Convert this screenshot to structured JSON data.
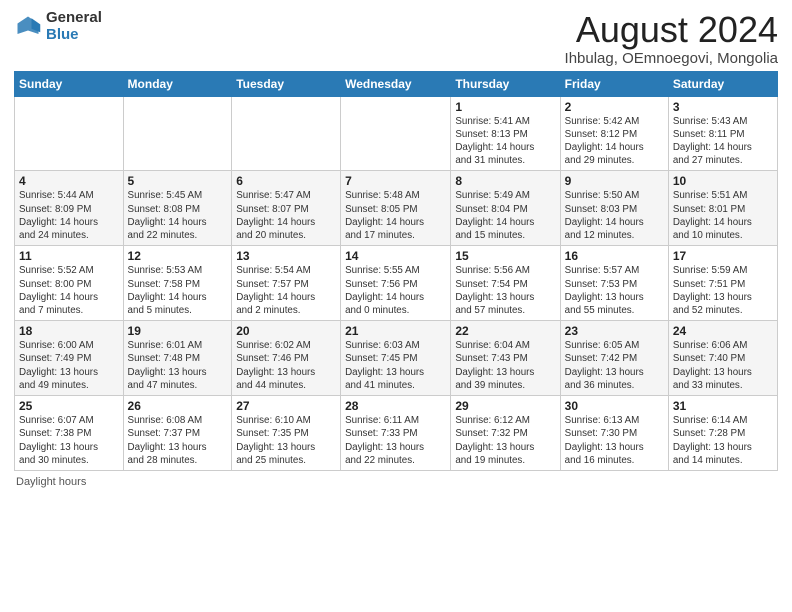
{
  "header": {
    "logo_line1": "General",
    "logo_line2": "Blue",
    "main_title": "August 2024",
    "sub_title": "Ihbulag, OEmnoegovi, Mongolia"
  },
  "days": [
    "Sunday",
    "Monday",
    "Tuesday",
    "Wednesday",
    "Thursday",
    "Friday",
    "Saturday"
  ],
  "weeks": [
    [
      {
        "date": "",
        "info": ""
      },
      {
        "date": "",
        "info": ""
      },
      {
        "date": "",
        "info": ""
      },
      {
        "date": "",
        "info": ""
      },
      {
        "date": "1",
        "info": "Sunrise: 5:41 AM\nSunset: 8:13 PM\nDaylight: 14 hours\nand 31 minutes."
      },
      {
        "date": "2",
        "info": "Sunrise: 5:42 AM\nSunset: 8:12 PM\nDaylight: 14 hours\nand 29 minutes."
      },
      {
        "date": "3",
        "info": "Sunrise: 5:43 AM\nSunset: 8:11 PM\nDaylight: 14 hours\nand 27 minutes."
      }
    ],
    [
      {
        "date": "4",
        "info": "Sunrise: 5:44 AM\nSunset: 8:09 PM\nDaylight: 14 hours\nand 24 minutes."
      },
      {
        "date": "5",
        "info": "Sunrise: 5:45 AM\nSunset: 8:08 PM\nDaylight: 14 hours\nand 22 minutes."
      },
      {
        "date": "6",
        "info": "Sunrise: 5:47 AM\nSunset: 8:07 PM\nDaylight: 14 hours\nand 20 minutes."
      },
      {
        "date": "7",
        "info": "Sunrise: 5:48 AM\nSunset: 8:05 PM\nDaylight: 14 hours\nand 17 minutes."
      },
      {
        "date": "8",
        "info": "Sunrise: 5:49 AM\nSunset: 8:04 PM\nDaylight: 14 hours\nand 15 minutes."
      },
      {
        "date": "9",
        "info": "Sunrise: 5:50 AM\nSunset: 8:03 PM\nDaylight: 14 hours\nand 12 minutes."
      },
      {
        "date": "10",
        "info": "Sunrise: 5:51 AM\nSunset: 8:01 PM\nDaylight: 14 hours\nand 10 minutes."
      }
    ],
    [
      {
        "date": "11",
        "info": "Sunrise: 5:52 AM\nSunset: 8:00 PM\nDaylight: 14 hours\nand 7 minutes."
      },
      {
        "date": "12",
        "info": "Sunrise: 5:53 AM\nSunset: 7:58 PM\nDaylight: 14 hours\nand 5 minutes."
      },
      {
        "date": "13",
        "info": "Sunrise: 5:54 AM\nSunset: 7:57 PM\nDaylight: 14 hours\nand 2 minutes."
      },
      {
        "date": "14",
        "info": "Sunrise: 5:55 AM\nSunset: 7:56 PM\nDaylight: 14 hours\nand 0 minutes."
      },
      {
        "date": "15",
        "info": "Sunrise: 5:56 AM\nSunset: 7:54 PM\nDaylight: 13 hours\nand 57 minutes."
      },
      {
        "date": "16",
        "info": "Sunrise: 5:57 AM\nSunset: 7:53 PM\nDaylight: 13 hours\nand 55 minutes."
      },
      {
        "date": "17",
        "info": "Sunrise: 5:59 AM\nSunset: 7:51 PM\nDaylight: 13 hours\nand 52 minutes."
      }
    ],
    [
      {
        "date": "18",
        "info": "Sunrise: 6:00 AM\nSunset: 7:49 PM\nDaylight: 13 hours\nand 49 minutes."
      },
      {
        "date": "19",
        "info": "Sunrise: 6:01 AM\nSunset: 7:48 PM\nDaylight: 13 hours\nand 47 minutes."
      },
      {
        "date": "20",
        "info": "Sunrise: 6:02 AM\nSunset: 7:46 PM\nDaylight: 13 hours\nand 44 minutes."
      },
      {
        "date": "21",
        "info": "Sunrise: 6:03 AM\nSunset: 7:45 PM\nDaylight: 13 hours\nand 41 minutes."
      },
      {
        "date": "22",
        "info": "Sunrise: 6:04 AM\nSunset: 7:43 PM\nDaylight: 13 hours\nand 39 minutes."
      },
      {
        "date": "23",
        "info": "Sunrise: 6:05 AM\nSunset: 7:42 PM\nDaylight: 13 hours\nand 36 minutes."
      },
      {
        "date": "24",
        "info": "Sunrise: 6:06 AM\nSunset: 7:40 PM\nDaylight: 13 hours\nand 33 minutes."
      }
    ],
    [
      {
        "date": "25",
        "info": "Sunrise: 6:07 AM\nSunset: 7:38 PM\nDaylight: 13 hours\nand 30 minutes."
      },
      {
        "date": "26",
        "info": "Sunrise: 6:08 AM\nSunset: 7:37 PM\nDaylight: 13 hours\nand 28 minutes."
      },
      {
        "date": "27",
        "info": "Sunrise: 6:10 AM\nSunset: 7:35 PM\nDaylight: 13 hours\nand 25 minutes."
      },
      {
        "date": "28",
        "info": "Sunrise: 6:11 AM\nSunset: 7:33 PM\nDaylight: 13 hours\nand 22 minutes."
      },
      {
        "date": "29",
        "info": "Sunrise: 6:12 AM\nSunset: 7:32 PM\nDaylight: 13 hours\nand 19 minutes."
      },
      {
        "date": "30",
        "info": "Sunrise: 6:13 AM\nSunset: 7:30 PM\nDaylight: 13 hours\nand 16 minutes."
      },
      {
        "date": "31",
        "info": "Sunrise: 6:14 AM\nSunset: 7:28 PM\nDaylight: 13 hours\nand 14 minutes."
      }
    ]
  ],
  "footer": {
    "note": "Daylight hours"
  }
}
